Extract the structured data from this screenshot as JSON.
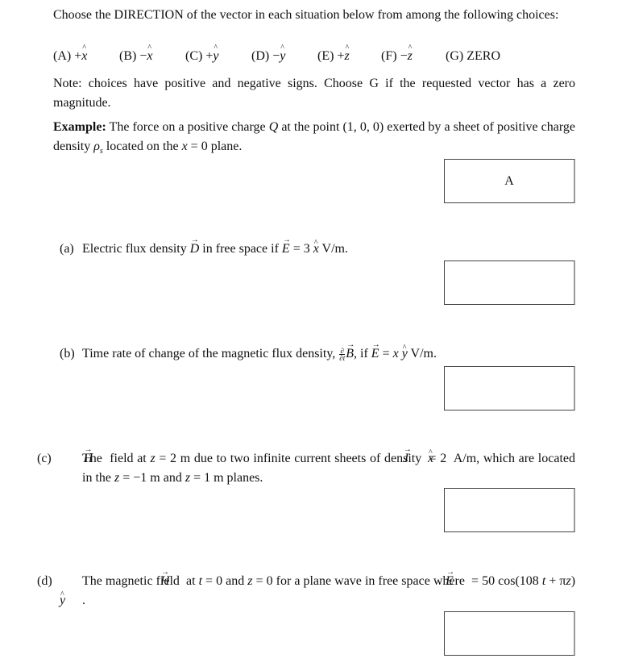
{
  "instructions": {
    "line1": "Choose the DIRECTION of the vector in each situation below from among the following choices:",
    "choices": [
      {
        "label": "(A)",
        "sign": "+",
        "unit": "x"
      },
      {
        "label": "(B)",
        "sign": "−",
        "unit": "x"
      },
      {
        "label": "(C)",
        "sign": "+",
        "unit": "y"
      },
      {
        "label": "(D)",
        "sign": "−",
        "unit": "y"
      },
      {
        "label": "(E)",
        "sign": "+",
        "unit": "z"
      },
      {
        "label": "(F)",
        "sign": "−",
        "unit": "z"
      },
      {
        "label": "(G)",
        "sign": "",
        "unit": "",
        "text": "ZERO"
      }
    ],
    "note": "Note: choices have positive and negative signs. Choose G if the requested vector has a zero magnitude."
  },
  "example": {
    "label": "Example:",
    "text_1": " The force on a positive charge ",
    "Q": "Q",
    "text_2": " at the point (1, 0, 0) exerted by a sheet of positive charge density ",
    "rho": "ρ",
    "rho_sub": "s",
    "text_3": " located on the ",
    "x": "x",
    "text_4": " = 0 plane.",
    "answer": "A"
  },
  "questions": [
    {
      "label": "(a)",
      "parts": [
        "Electric flux density ",
        "D",
        " in free space if ",
        "E",
        " = 3 ",
        "x",
        " V/m."
      ],
      "answer": ""
    },
    {
      "label": "(b)",
      "parts": [
        "Time rate of change of the magnetic flux density, ",
        "∂",
        "∂t",
        "B",
        ", if ",
        "E",
        " = ",
        "x",
        " ",
        "y",
        " V/m."
      ],
      "answer": ""
    },
    {
      "label": "(c)",
      "parts": [
        "The ",
        "H",
        " field at ",
        "z",
        " = 2 m due to two infinite current sheets of density ",
        "J",
        " = 2 ",
        "x",
        " A/m, which are located in the ",
        "z",
        " = −1 m and ",
        "z",
        " = 1 m planes."
      ],
      "answer": ""
    },
    {
      "label": "(d)",
      "parts": [
        "The magnetic field ",
        "H",
        " at ",
        "t",
        " = 0 and ",
        "z",
        " = 0 for a plane wave in free space where ",
        "E",
        " = 50 cos(108 ",
        "t",
        " + π",
        "z",
        ") ",
        "y",
        "."
      ],
      "answer": ""
    }
  ]
}
